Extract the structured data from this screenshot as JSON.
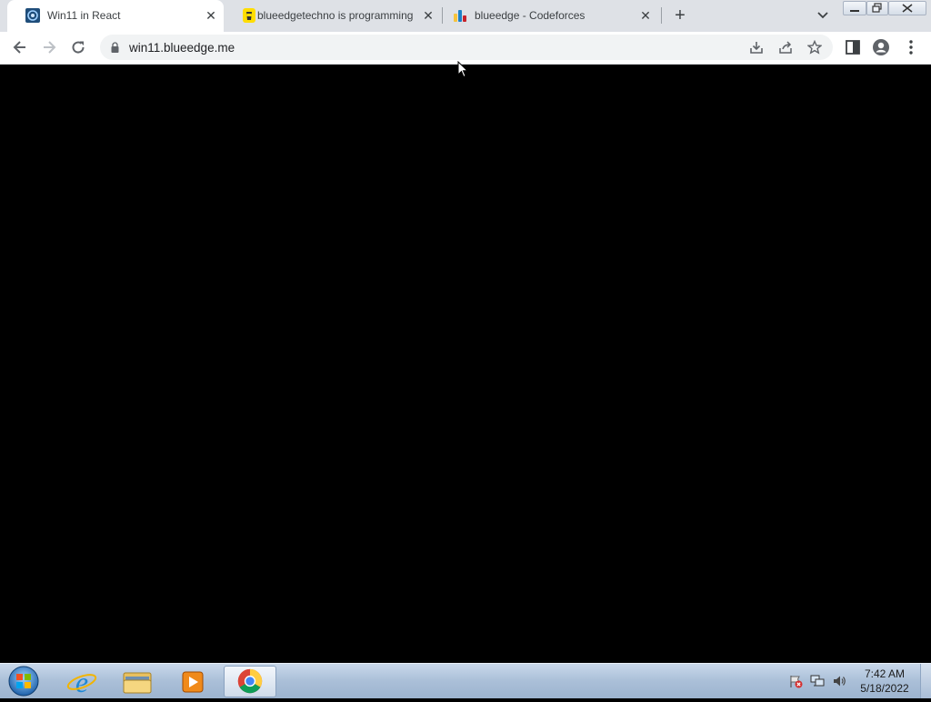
{
  "browser": {
    "tabs": [
      {
        "title": "Win11 in React",
        "favicon": "win11-app-icon",
        "active": true
      },
      {
        "title": "blueedgetechno is programming",
        "favicon": "buymeacoffee-icon",
        "active": false
      },
      {
        "title": "blueedge - Codeforces",
        "favicon": "codeforces-icon",
        "active": false
      }
    ],
    "new_tab_label": "+",
    "address": {
      "url": "win11.blueedge.me",
      "secure": true
    }
  },
  "taskbar": {
    "apps": [
      "start-orb",
      "internet-explorer",
      "file-explorer",
      "media-player",
      "chrome"
    ],
    "clock": {
      "time": "7:42 AM",
      "date": "5/18/2022"
    }
  }
}
